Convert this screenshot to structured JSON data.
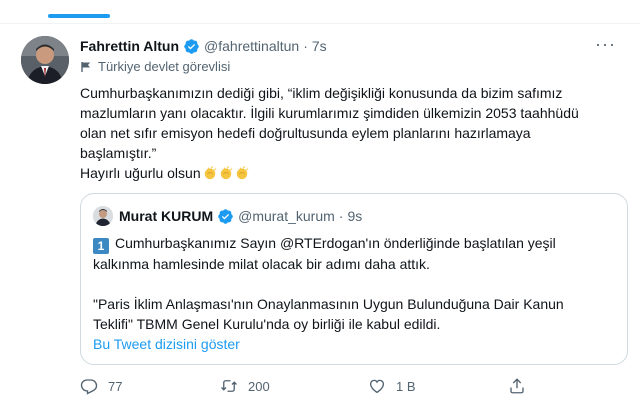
{
  "tweet": {
    "author_name": "Fahrettin Altun",
    "author_handle": "@fahrettinaltun",
    "separator": "·",
    "time": "7s",
    "label": "Türkiye devlet görevlisi",
    "more_glyph": "···",
    "text_lines": [
      "Cumhurbaşkanımızın dediği gibi, “iklim değişikliği konusunda da bizim safımız",
      "mazlumların yanı olacaktır. İlgili kurumlarımız şimdiden ülkemizin 2053 taahhüdü",
      "olan net sıfır emisyon hedefi doğrultusunda eylem planlarını hazırlamaya",
      "başlamıştır.”",
      "Hayırlı uğurlu olsun"
    ],
    "emoji": [
      "clapping-hands",
      "clapping-hands",
      "clapping-hands"
    ]
  },
  "quote": {
    "author_name": "Murat KURUM",
    "author_handle": "@murat_kurum",
    "separator": "·",
    "time": "9s",
    "number_badge": "1",
    "paragraph1_lines": [
      "Cumhurbaşkanımız Sayın @RTErdogan'ın önderliğinde başlatılan yeşil",
      "kalkınma hamlesinde milat olacak bir adımı daha attık."
    ],
    "paragraph2_lines": [
      "\"Paris İklim Anlaşması'nın Onaylanmasının Uygun Bulunduğuna Dair Kanun",
      "Teklifi\" TBMM Genel Kurulu'nda oy birliği ile kabul edildi."
    ],
    "show_thread": "Bu Tweet dizisini göster"
  },
  "actions": {
    "reply_count": "77",
    "retweet_count": "200",
    "like_count": "1 B",
    "share_label": ""
  },
  "colors": {
    "accent": "#1d9bf0",
    "text": "#0f1419",
    "secondary": "#536471",
    "border": "#cfd9de"
  },
  "icons": [
    "verified-badge-icon",
    "flag-icon",
    "more-icon",
    "reply-icon",
    "retweet-icon",
    "like-icon",
    "share-icon",
    "keycap-1-icon",
    "clapping-hands-icon"
  ]
}
